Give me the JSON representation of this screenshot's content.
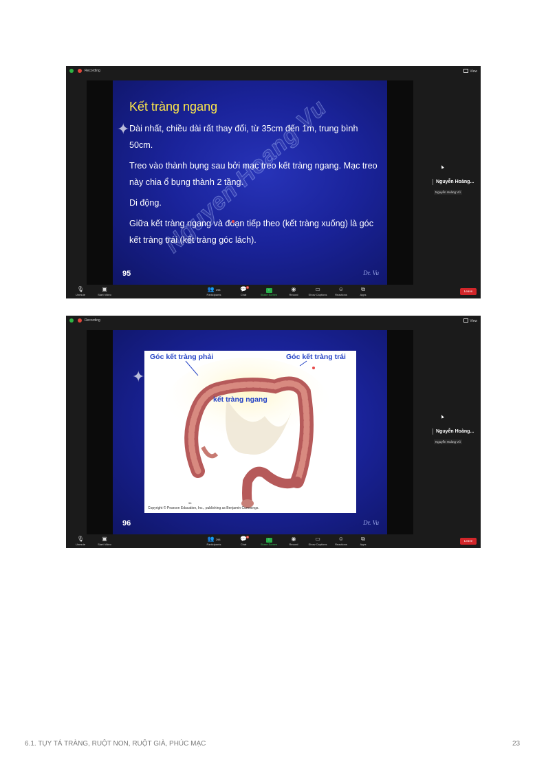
{
  "meeting": {
    "recording_label": "Recording",
    "view_label": "View",
    "participant_name": "Nguyễn Hoàng...",
    "participant_tag": "Nguyễn Hoàng Vũ",
    "watermark": "Nguyen Hoang Vu",
    "presenter_sig": "Dr. Vu"
  },
  "toolbar": {
    "unmute": "Unmute",
    "start_video": "Start Video",
    "participants_count": "298",
    "participants": "Participants",
    "chat": "Chat",
    "chat_badge": "6",
    "share_screen": "Share Screen",
    "record": "Record",
    "show_captions": "Show Captions",
    "reactions": "Reactions",
    "apps": "Apps",
    "leave": "Leave"
  },
  "slide1": {
    "title": "Kết tràng ngang",
    "bullets": [
      "Dài nhất, chiều dài rất thay đổi, từ 35cm đến 1m, trung bình 50cm.",
      "Treo vào thành bụng sau bởi mạc treo kết tràng ngang. Mạc treo này chia ổ bụng thành 2 tầng.",
      "Di động.",
      "Giữa kết tràng ngang và đoạn tiếp theo (kết tràng xuống) là góc kết tràng trái (kết tràng góc lách)."
    ],
    "number": "95"
  },
  "slide2": {
    "label_right_flexure": "Góc kết tràng phải",
    "label_left_flexure": "Góc kết tràng trái",
    "label_transverse": "kết tràng ngang",
    "copyright": "Copyright © Pearson Education, Inc., publishing as Benjamin Cummings.",
    "figure_no": "96",
    "number": "96"
  },
  "footer": {
    "chapter": "6.1. TỤY TÁ TRÀNG, RUỘT NON, RUỘT GIÀ, PHÚC MẠC",
    "page": "23"
  }
}
